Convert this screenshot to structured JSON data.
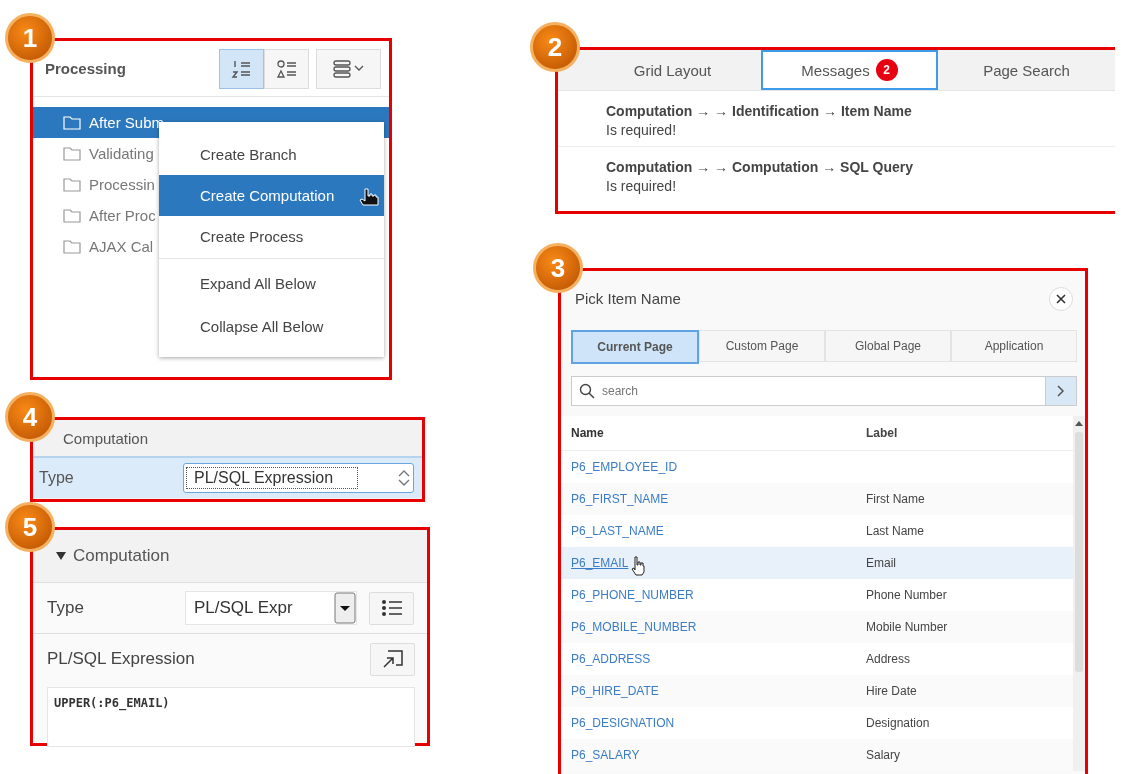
{
  "processing_panel": {
    "callout": "1",
    "title": "Processing",
    "tree_items": [
      {
        "label": "After Subm",
        "selected": true
      },
      {
        "label": "Validating",
        "selected": false
      },
      {
        "label": "Processin",
        "selected": false
      },
      {
        "label": "After Proc",
        "selected": false
      },
      {
        "label": "AJAX Cal",
        "selected": false
      }
    ],
    "context_menu": [
      {
        "label": "Create Branch",
        "selected": false,
        "separator_before": false
      },
      {
        "label": "Create Computation",
        "selected": true,
        "separator_before": false
      },
      {
        "label": "Create Process",
        "selected": false,
        "separator_before": false
      },
      {
        "label": "Expand All Below",
        "selected": false,
        "separator_before": true
      },
      {
        "label": "Collapse All Below",
        "selected": false,
        "separator_before": false
      }
    ]
  },
  "messages_panel": {
    "callout": "2",
    "tabs": [
      {
        "label": "Grid Layout",
        "selected": false
      },
      {
        "label": "Messages",
        "selected": true,
        "badge": "2"
      },
      {
        "label": "Page Search",
        "selected": false
      }
    ],
    "messages": [
      {
        "path": "Computation → → Identification → Item Name",
        "text": "Is required!"
      },
      {
        "path": "Computation → → Computation → SQL Query",
        "text": "Is required!"
      }
    ]
  },
  "pick_item_dialog": {
    "callout": "3",
    "title": "Pick Item Name",
    "tabs": [
      {
        "label": "Current Page",
        "selected": true
      },
      {
        "label": "Custom Page",
        "selected": false
      },
      {
        "label": "Global Page",
        "selected": false
      },
      {
        "label": "Application",
        "selected": false
      }
    ],
    "search": {
      "placeholder": "search"
    },
    "table": {
      "columns": [
        "Name",
        "Label"
      ],
      "rows": [
        {
          "name": "P6_EMPLOYEE_ID",
          "label": "",
          "selected": false
        },
        {
          "name": "P6_FIRST_NAME",
          "label": "First Name",
          "selected": false
        },
        {
          "name": "P6_LAST_NAME",
          "label": "Last Name",
          "selected": false
        },
        {
          "name": "P6_EMAIL",
          "label": "Email",
          "selected": true
        },
        {
          "name": "P6_PHONE_NUMBER",
          "label": "Phone Number",
          "selected": false
        },
        {
          "name": "P6_MOBILE_NUMBER",
          "label": "Mobile Number",
          "selected": false
        },
        {
          "name": "P6_ADDRESS",
          "label": "Address",
          "selected": false
        },
        {
          "name": "P6_HIRE_DATE",
          "label": "Hire Date",
          "selected": false
        },
        {
          "name": "P6_DESIGNATION",
          "label": "Designation",
          "selected": false
        },
        {
          "name": "P6_SALARY",
          "label": "Salary",
          "selected": false
        }
      ]
    }
  },
  "type_panel": {
    "callout": "4",
    "section": "Computation",
    "field_label": "Type",
    "value": "PL/SQL Expression"
  },
  "computation_panel": {
    "callout": "5",
    "section": "Computation",
    "type_label": "Type",
    "type_value": "PL/SQL Expr",
    "expression_label": "PL/SQL Expression",
    "code": "UPPER(:P6_EMAIL)"
  }
}
